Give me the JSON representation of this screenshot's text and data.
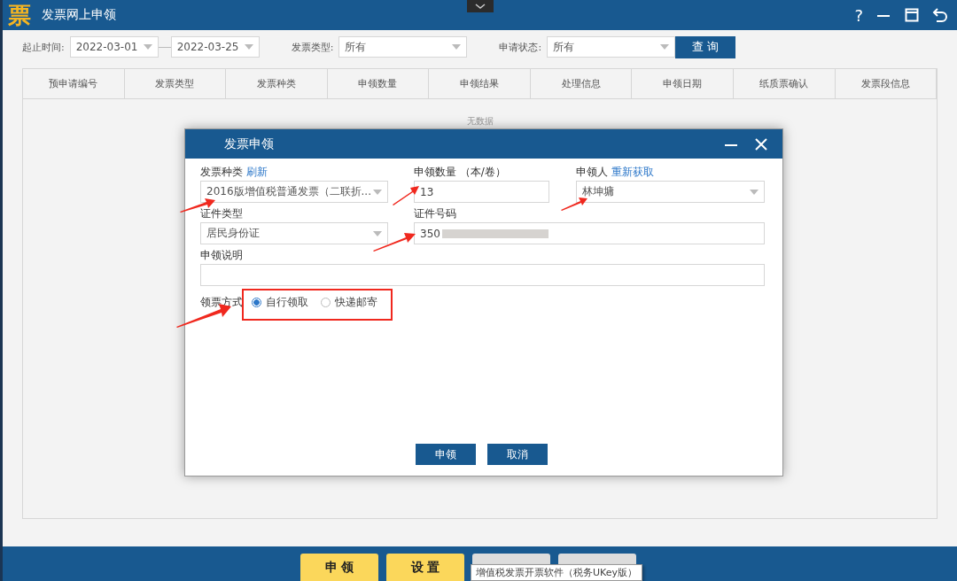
{
  "window": {
    "logo": "票",
    "title": "发票网上申领",
    "help": "?"
  },
  "filters": {
    "date_label": "起止时间:",
    "start": "2022-03-01",
    "end": "2022-03-25",
    "type_label": "发票类型:",
    "type_value": "所有",
    "status_label": "申请状态:",
    "status_value": "所有",
    "query": "查 询"
  },
  "table": {
    "columns": [
      "预申请编号",
      "发票类型",
      "发票种类",
      "申领数量",
      "申领结果",
      "处理信息",
      "申领日期",
      "纸质票确认",
      "发票段信息"
    ],
    "empty": "无数据"
  },
  "dialog": {
    "title": "发票申领",
    "kind_label": "发票种类",
    "kind_link": "刷新",
    "kind_value": "2016版增值税普通发票（二联折...",
    "qty_label": "申领数量 （本/卷）",
    "qty_value": "13",
    "person_label": "申领人",
    "person_link": "重新获取",
    "person_value": "林坤墉",
    "id_type_label": "证件类型",
    "id_type_value": "居民身份证",
    "id_no_label": "证件号码",
    "id_no_value": "350",
    "id_no_redacted": true,
    "note_label": "申领说明",
    "method_label": "领票方式",
    "methods": [
      {
        "label": "自行领取",
        "selected": true
      },
      {
        "label": "快递邮寄",
        "selected": false
      }
    ],
    "buttons": [
      "申领",
      "取消"
    ]
  },
  "footer": {
    "buttons": [
      {
        "kind": "yellow",
        "label": "申 领"
      },
      {
        "kind": "yellow",
        "label": "设 置"
      },
      {
        "kind": "covered"
      },
      {
        "kind": "covered"
      }
    ],
    "tooltip": "增值税发票开票软件（税务UKey版）"
  }
}
